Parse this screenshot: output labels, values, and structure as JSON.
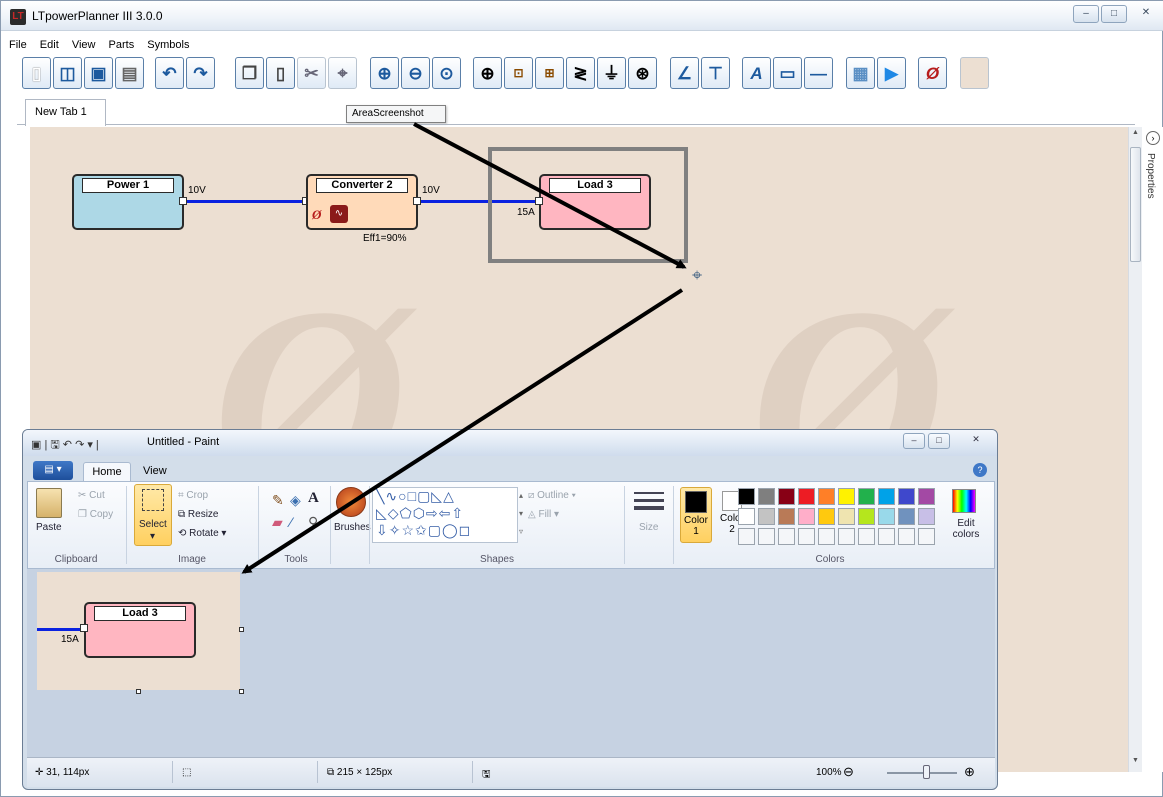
{
  "app": {
    "title": "LTpowerPlanner III 3.0.0",
    "logo_text": "LT",
    "window_controls": [
      "–",
      "□",
      "✕"
    ]
  },
  "menu": [
    "File",
    "Edit",
    "View",
    "Parts",
    "Symbols"
  ],
  "toolbar": {
    "tooltip": "AreaScreenshot",
    "icons": [
      "new-document-icon",
      "open-icon",
      "save-icon",
      "print-icon",
      "undo-icon",
      "redo-icon",
      "copy-icon",
      "paste-icon",
      "cut-icon",
      "area-screenshot-icon",
      "zoom-in-icon",
      "zoom-out-icon",
      "zoom-fit-icon",
      "add-power-source-icon",
      "add-converter-icon",
      "add-ldo-icon",
      "add-resistor-icon",
      "add-ground-icon",
      "add-load-icon",
      "draw-line-icon",
      "connector-icon",
      "text-icon",
      "rectangle-icon",
      "horizontal-line-icon",
      "calculator-icon",
      "run-icon",
      "lt-logo-icon",
      "color-swatch-icon"
    ]
  },
  "tabs": [
    {
      "label": "New Tab 1"
    }
  ],
  "canvas": {
    "background": "#ecdfd2",
    "blocks": [
      {
        "name": "Power 1",
        "color": "#add8e6",
        "output": "10V"
      },
      {
        "name": "Converter 2",
        "color": "#ffdab9",
        "output": "10V",
        "efficiency": "Eff1=90%"
      },
      {
        "name": "Load 3",
        "color": "#ffb6c1",
        "input": "15A"
      }
    ],
    "wire_color": "#0a22e0"
  },
  "side_panel": {
    "label": "Properties"
  },
  "paint": {
    "title": "Untitled - Paint",
    "quick_access": "▣ | 🖫 ↶ ↷ ▾ |",
    "tabs": [
      "Home",
      "View"
    ],
    "app_menu": "▤ ▾",
    "clipboard": {
      "paste": "Paste",
      "cut": "Cut",
      "copy": "Copy",
      "label": "Clipboard"
    },
    "image": {
      "select": "Select",
      "crop": "Crop",
      "resize": "Resize",
      "rotate": "Rotate",
      "label": "Image"
    },
    "tools": {
      "label": "Tools"
    },
    "brushes": {
      "label": "Brushes"
    },
    "shapes": {
      "outline": "Outline",
      "fill": "Fill",
      "label": "Shapes"
    },
    "size": {
      "label": "Size"
    },
    "colors": {
      "color1": "Color 1",
      "color2": "Color 2",
      "edit": "Edit colors",
      "label": "Colors",
      "palette": [
        "#000000",
        "#7f7f7f",
        "#880015",
        "#ed1c24",
        "#ff7f27",
        "#fff200",
        "#22b14c",
        "#00a2e8",
        "#3f48cc",
        "#a349a4",
        "#ffffff",
        "#c3c3c3",
        "#b97a57",
        "#ffaec9",
        "#ffc90e",
        "#efe4b0",
        "#b5e61d",
        "#99d9ea",
        "#7092be",
        "#c8bfe7",
        "#f4f6f9",
        "#f4f6f9",
        "#f4f6f9",
        "#f4f6f9",
        "#f4f6f9",
        "#f4f6f9",
        "#f4f6f9",
        "#f4f6f9",
        "#f4f6f9",
        "#f4f6f9"
      ]
    },
    "image_content": {
      "block": "Load 3",
      "input": "15A"
    },
    "status": {
      "cursor": "31, 114px",
      "selection": "215 × 125px",
      "zoom": "100%"
    }
  }
}
